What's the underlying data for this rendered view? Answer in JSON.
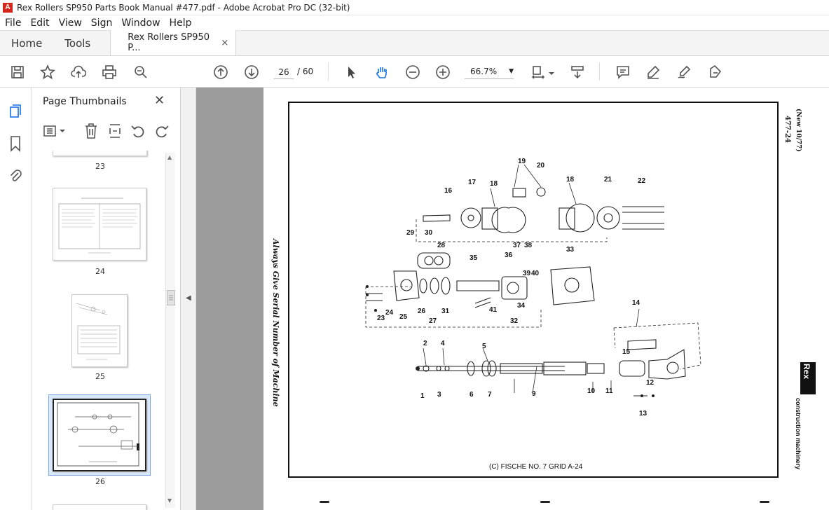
{
  "window": {
    "title": "Rex Rollers SP950 Parts Book Manual #477.pdf - Adobe Acrobat Pro DC (32-bit)"
  },
  "menu": [
    "File",
    "Edit",
    "View",
    "Sign",
    "Window",
    "Help"
  ],
  "tabs": {
    "home": "Home",
    "tools": "Tools",
    "document": "Rex Rollers SP950 P...",
    "close": "×"
  },
  "toolbar": {
    "page_current": "26",
    "page_total": "/ 60",
    "zoom": "66.7%"
  },
  "panel": {
    "title": "Page Thumbnails",
    "thumbs": [
      {
        "label": "23"
      },
      {
        "label": "24"
      },
      {
        "label": "25"
      },
      {
        "label": "26",
        "selected": true
      }
    ]
  },
  "pdf_page": {
    "side_code": "477-24",
    "side_revision": "(New 10/77)",
    "vertical_note": "Always Give Serial Number of Machine",
    "brand": "Rex",
    "brand_sub": "construction machinery",
    "footer": "(C) FISCHE NO. 7 GRID A-24",
    "part_numbers": [
      "1",
      "2",
      "3",
      "4",
      "5",
      "6",
      "7",
      "9",
      "10",
      "11",
      "12",
      "13",
      "14",
      "15",
      "16",
      "17",
      "18",
      "18",
      "19",
      "20",
      "21",
      "22",
      "23",
      "24",
      "25",
      "26",
      "27",
      "28",
      "29",
      "30",
      "31",
      "32",
      "33",
      "34",
      "35",
      "36",
      "37",
      "38",
      "39",
      "40",
      "41"
    ]
  },
  "colors": {
    "accent": "#1473e6",
    "pdf_red": "#d4271e",
    "doc_bg": "#9c9c9c"
  }
}
